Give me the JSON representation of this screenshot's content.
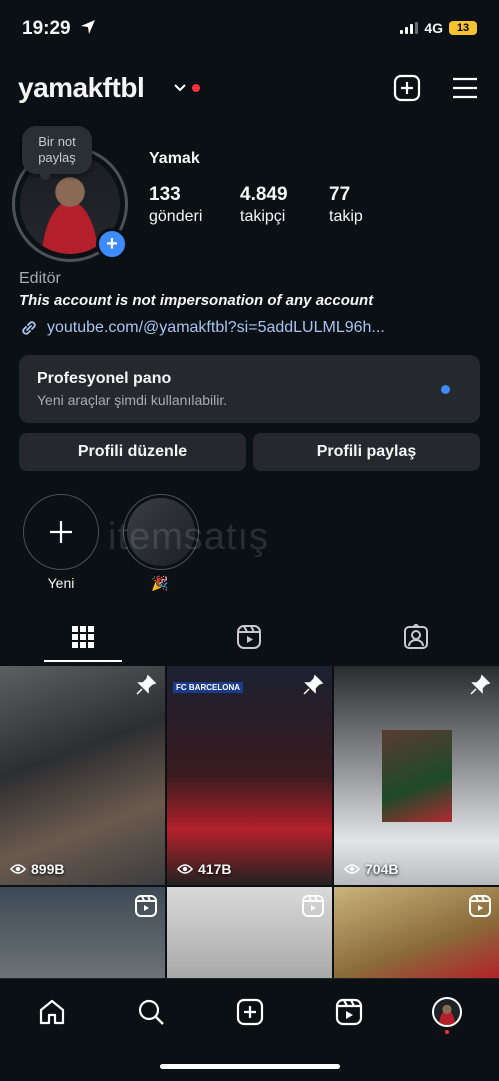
{
  "status": {
    "time": "19:29",
    "network": "4G",
    "battery": "13"
  },
  "header": {
    "username": "yamakftbl"
  },
  "profile": {
    "note": "Bir not paylaş",
    "display_name": "Yamak",
    "stats": [
      {
        "value": "133",
        "label": "gönderi"
      },
      {
        "value": "4.849",
        "label": "takipçi"
      },
      {
        "value": "77",
        "label": "takip"
      }
    ],
    "category": "Editör",
    "bio": "This account is not impersonation of any account",
    "link": "youtube.com/@yamakftbl?si=5addLULML96h..."
  },
  "pro_panel": {
    "title": "Profesyonel pano",
    "subtitle": "Yeni araçlar şimdi kullanılabilir."
  },
  "buttons": {
    "edit": "Profili düzenle",
    "share": "Profili paylaş"
  },
  "highlights": [
    {
      "label": "Yeni"
    },
    {
      "label": "🎉"
    }
  ],
  "watermark": "itemsatış",
  "posts": [
    {
      "count": "899B",
      "pinned": true
    },
    {
      "count": "417B",
      "pinned": true,
      "banner": "FC BARCELONA"
    },
    {
      "count": "704B",
      "pinned": true
    },
    {
      "reel": true
    },
    {
      "reel": true
    },
    {
      "reel": true
    }
  ],
  "colors": {
    "accent": "#3d8bff",
    "background": "#0b1014",
    "panel": "#25292e",
    "notification": "#ff3040"
  }
}
